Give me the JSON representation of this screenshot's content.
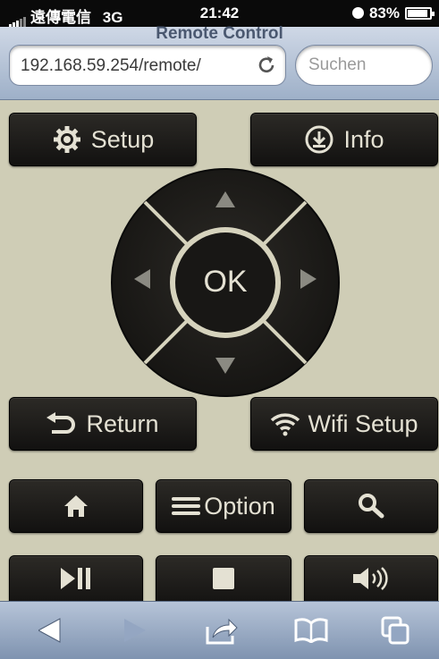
{
  "status_bar": {
    "carrier": "遠傳電信",
    "network": "3G",
    "time": "21:42",
    "battery": "83%",
    "battery_level": 0.83
  },
  "browser": {
    "page_title": "Remote Control",
    "url": "192.168.59.254/remote/",
    "search_placeholder": "Suchen"
  },
  "remote": {
    "setup_label": "Setup",
    "info_label": "Info",
    "ok_label": "OK",
    "return_label": "Return",
    "wifi_setup_label": "Wifi Setup",
    "option_label": "Option"
  },
  "colors": {
    "background": "#cfcdb6",
    "button": "#1e1c1a",
    "button_text": "#e4e1d3",
    "ring": "#d6d3bd"
  },
  "icons": {
    "status": [
      "signal-bars-icon",
      "alarm-icon",
      "battery-icon"
    ],
    "remote": [
      "gear-icon",
      "download-circle-icon",
      "arrow-up-icon",
      "arrow-down-icon",
      "arrow-left-icon",
      "arrow-right-icon",
      "return-arrow-icon",
      "wifi-icon",
      "home-icon",
      "menu-lines-icon",
      "search-icon",
      "play-pause-icon",
      "stop-icon",
      "volume-icon"
    ],
    "toolbar": [
      "back-icon",
      "forward-icon",
      "share-icon",
      "bookmarks-icon",
      "tabs-icon"
    ]
  }
}
